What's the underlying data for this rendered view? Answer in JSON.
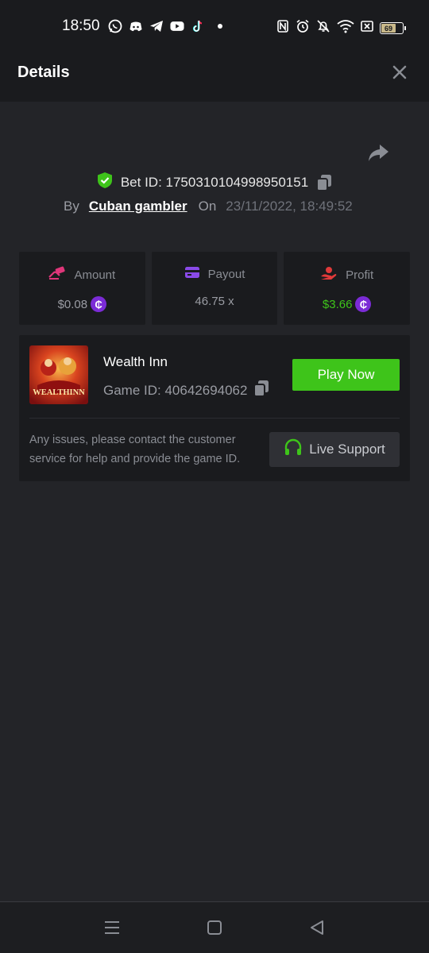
{
  "status_bar": {
    "time": "18:50",
    "notification_icons": [
      "whatsapp-icon",
      "discord-icon",
      "telegram-icon",
      "youtube-icon",
      "tiktok-icon"
    ],
    "battery_level": "69"
  },
  "header": {
    "title": "Details"
  },
  "bet": {
    "id_label": "Bet ID: 1750310104998950151",
    "by_label": "By",
    "username": "Cuban gambler",
    "on_label": "On",
    "datetime": "23/11/2022, 18:49:52"
  },
  "stats": {
    "amount": {
      "label": "Amount",
      "value": "$0.08"
    },
    "payout": {
      "label": "Payout",
      "value": "46.75 x"
    },
    "profit": {
      "label": "Profit",
      "value": "$3.66"
    },
    "coin_symbol": "₵"
  },
  "game": {
    "name": "Wealth Inn",
    "id_label": "Game ID: 40642694062",
    "thumb_text": "WEALTHINN",
    "play_label": "Play Now"
  },
  "support": {
    "help_text": "Any issues, please contact the customer service for help and provide the game ID.",
    "button_label": "Live Support"
  },
  "colors": {
    "accent_green": "#3ec41a",
    "coin_purple": "#7b2bd6",
    "background": "#232428",
    "panel": "#1a1b1e"
  }
}
